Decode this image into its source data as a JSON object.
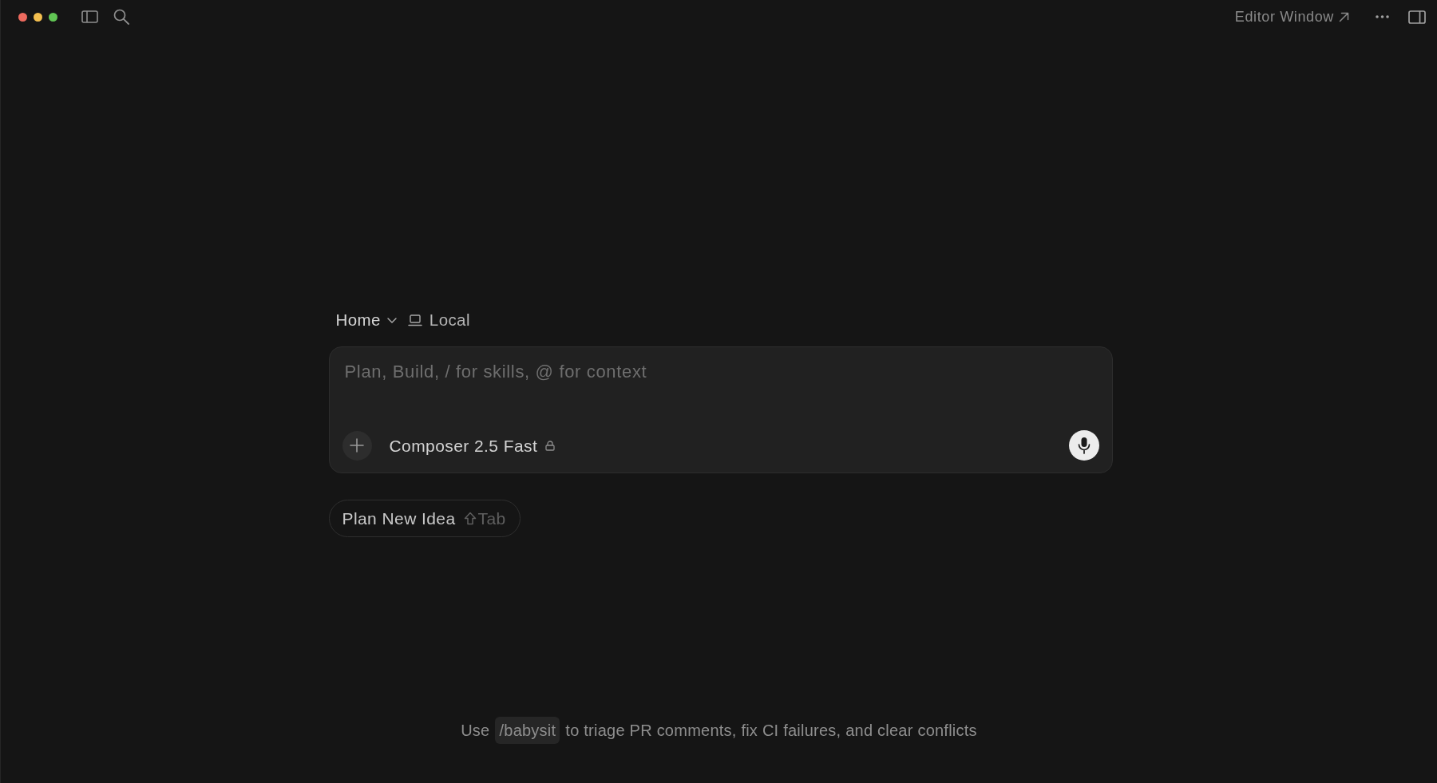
{
  "toolbar": {
    "editor_window": "Editor Window"
  },
  "composer": {
    "location": "Home",
    "environment": "Local",
    "placeholder": "Plan, Build, / for skills, @ for context",
    "model": "Composer 2.5 Fast"
  },
  "suggestion": {
    "label": "Plan New Idea",
    "shortcut": "Tab"
  },
  "tip": {
    "before": "Use",
    "command": "/babysit",
    "after": "to triage PR comments, fix CI failures, and clear conflicts"
  }
}
